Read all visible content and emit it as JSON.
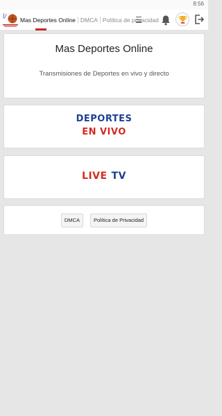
{
  "status_bar": {
    "time": "8:56"
  },
  "app_bar": {
    "tabs": [
      {
        "label": "Mas Deportes Online",
        "active": true
      },
      {
        "label": "DMCA",
        "active": false
      },
      {
        "label": "Política de privacidad",
        "active": false
      }
    ],
    "icons": [
      "logo-icon",
      "menu-icon",
      "bell-icon",
      "trophy-icon",
      "exit-icon"
    ],
    "colors": {
      "accent": "#c62828",
      "blue": "#1d3f93",
      "red": "#d32c1f"
    }
  },
  "main": {
    "header_card": {
      "title": "Mas Deportes Online",
      "subtitle": "Transmisiones de Deportes en vivo y directo"
    },
    "deportes_card": {
      "line1": "DEPORTES",
      "line2": "EN VIVO"
    },
    "live_card": {
      "word1": "LIVE",
      "word2": "TV"
    },
    "links_card": {
      "dmca": "DMCA",
      "privacy": "Política de Privacidad"
    }
  }
}
